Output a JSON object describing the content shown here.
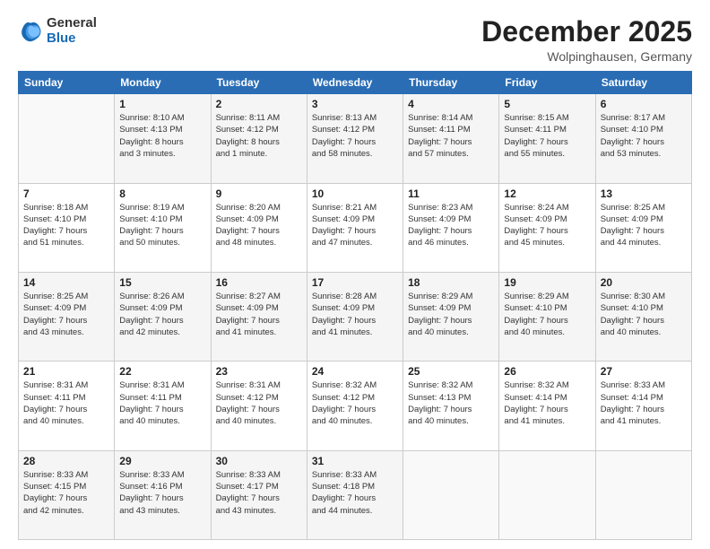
{
  "logo": {
    "general": "General",
    "blue": "Blue"
  },
  "header": {
    "month": "December 2025",
    "location": "Wolpinghausen, Germany"
  },
  "days_of_week": [
    "Sunday",
    "Monday",
    "Tuesday",
    "Wednesday",
    "Thursday",
    "Friday",
    "Saturday"
  ],
  "weeks": [
    [
      {
        "day": "",
        "content": ""
      },
      {
        "day": "1",
        "content": "Sunrise: 8:10 AM\nSunset: 4:13 PM\nDaylight: 8 hours\nand 3 minutes."
      },
      {
        "day": "2",
        "content": "Sunrise: 8:11 AM\nSunset: 4:12 PM\nDaylight: 8 hours\nand 1 minute."
      },
      {
        "day": "3",
        "content": "Sunrise: 8:13 AM\nSunset: 4:12 PM\nDaylight: 7 hours\nand 58 minutes."
      },
      {
        "day": "4",
        "content": "Sunrise: 8:14 AM\nSunset: 4:11 PM\nDaylight: 7 hours\nand 57 minutes."
      },
      {
        "day": "5",
        "content": "Sunrise: 8:15 AM\nSunset: 4:11 PM\nDaylight: 7 hours\nand 55 minutes."
      },
      {
        "day": "6",
        "content": "Sunrise: 8:17 AM\nSunset: 4:10 PM\nDaylight: 7 hours\nand 53 minutes."
      }
    ],
    [
      {
        "day": "7",
        "content": "Sunrise: 8:18 AM\nSunset: 4:10 PM\nDaylight: 7 hours\nand 51 minutes."
      },
      {
        "day": "8",
        "content": "Sunrise: 8:19 AM\nSunset: 4:10 PM\nDaylight: 7 hours\nand 50 minutes."
      },
      {
        "day": "9",
        "content": "Sunrise: 8:20 AM\nSunset: 4:09 PM\nDaylight: 7 hours\nand 48 minutes."
      },
      {
        "day": "10",
        "content": "Sunrise: 8:21 AM\nSunset: 4:09 PM\nDaylight: 7 hours\nand 47 minutes."
      },
      {
        "day": "11",
        "content": "Sunrise: 8:23 AM\nSunset: 4:09 PM\nDaylight: 7 hours\nand 46 minutes."
      },
      {
        "day": "12",
        "content": "Sunrise: 8:24 AM\nSunset: 4:09 PM\nDaylight: 7 hours\nand 45 minutes."
      },
      {
        "day": "13",
        "content": "Sunrise: 8:25 AM\nSunset: 4:09 PM\nDaylight: 7 hours\nand 44 minutes."
      }
    ],
    [
      {
        "day": "14",
        "content": "Sunrise: 8:25 AM\nSunset: 4:09 PM\nDaylight: 7 hours\nand 43 minutes."
      },
      {
        "day": "15",
        "content": "Sunrise: 8:26 AM\nSunset: 4:09 PM\nDaylight: 7 hours\nand 42 minutes."
      },
      {
        "day": "16",
        "content": "Sunrise: 8:27 AM\nSunset: 4:09 PM\nDaylight: 7 hours\nand 41 minutes."
      },
      {
        "day": "17",
        "content": "Sunrise: 8:28 AM\nSunset: 4:09 PM\nDaylight: 7 hours\nand 41 minutes."
      },
      {
        "day": "18",
        "content": "Sunrise: 8:29 AM\nSunset: 4:09 PM\nDaylight: 7 hours\nand 40 minutes."
      },
      {
        "day": "19",
        "content": "Sunrise: 8:29 AM\nSunset: 4:10 PM\nDaylight: 7 hours\nand 40 minutes."
      },
      {
        "day": "20",
        "content": "Sunrise: 8:30 AM\nSunset: 4:10 PM\nDaylight: 7 hours\nand 40 minutes."
      }
    ],
    [
      {
        "day": "21",
        "content": "Sunrise: 8:31 AM\nSunset: 4:11 PM\nDaylight: 7 hours\nand 40 minutes."
      },
      {
        "day": "22",
        "content": "Sunrise: 8:31 AM\nSunset: 4:11 PM\nDaylight: 7 hours\nand 40 minutes."
      },
      {
        "day": "23",
        "content": "Sunrise: 8:31 AM\nSunset: 4:12 PM\nDaylight: 7 hours\nand 40 minutes."
      },
      {
        "day": "24",
        "content": "Sunrise: 8:32 AM\nSunset: 4:12 PM\nDaylight: 7 hours\nand 40 minutes."
      },
      {
        "day": "25",
        "content": "Sunrise: 8:32 AM\nSunset: 4:13 PM\nDaylight: 7 hours\nand 40 minutes."
      },
      {
        "day": "26",
        "content": "Sunrise: 8:32 AM\nSunset: 4:14 PM\nDaylight: 7 hours\nand 41 minutes."
      },
      {
        "day": "27",
        "content": "Sunrise: 8:33 AM\nSunset: 4:14 PM\nDaylight: 7 hours\nand 41 minutes."
      }
    ],
    [
      {
        "day": "28",
        "content": "Sunrise: 8:33 AM\nSunset: 4:15 PM\nDaylight: 7 hours\nand 42 minutes."
      },
      {
        "day": "29",
        "content": "Sunrise: 8:33 AM\nSunset: 4:16 PM\nDaylight: 7 hours\nand 43 minutes."
      },
      {
        "day": "30",
        "content": "Sunrise: 8:33 AM\nSunset: 4:17 PM\nDaylight: 7 hours\nand 43 minutes."
      },
      {
        "day": "31",
        "content": "Sunrise: 8:33 AM\nSunset: 4:18 PM\nDaylight: 7 hours\nand 44 minutes."
      },
      {
        "day": "",
        "content": ""
      },
      {
        "day": "",
        "content": ""
      },
      {
        "day": "",
        "content": ""
      }
    ]
  ]
}
